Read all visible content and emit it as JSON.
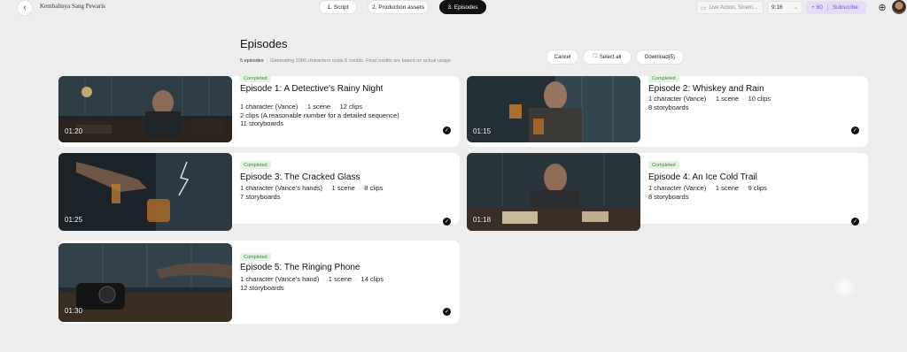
{
  "header": {
    "project_title": "Kembalinya Sang Pewaris",
    "steps": [
      "1. Script",
      "2. Production assets",
      "3. Episodes"
    ],
    "style_value": "Live Action, Sinem...",
    "ratio_value": "9:16",
    "credits": "+ 60",
    "subscribe": "Subscribe",
    "language_icon": "translate-icon"
  },
  "page": {
    "title": "Episodes",
    "count": "5 episodes",
    "cost_note": "Generating 1080 characters costs",
    "cost_credits": "6",
    "credits_word": "credits.",
    "final_note": "Final credits are based on actual usage."
  },
  "actions": {
    "cancel": "Cancel",
    "select_all": "Select all",
    "download": "Download(5)"
  },
  "episodes": [
    {
      "status": "Completed",
      "title": "Episode 1: A Detective's Rainy Night",
      "characters": "1 character (Vance)",
      "scenes": "1 scene",
      "clips": "12 clips",
      "extra": "2 clips (A reasonable number for a detailed sequence)",
      "storyboards": "11 storyboards",
      "duration": "01:20"
    },
    {
      "status": "Completed",
      "title": "Episode 2: Whiskey and Rain",
      "characters": "1 character (Vance)",
      "scenes": "1 scene",
      "clips": "10 clips",
      "storyboards": "8 storyboards",
      "duration": "01:15"
    },
    {
      "status": "Completed",
      "title": "Episode 3: The Cracked Glass",
      "characters": "1 character (Vance's hands)",
      "scenes": "1 scene",
      "clips": "8 clips",
      "storyboards": "7 storyboards",
      "duration": "01:25"
    },
    {
      "status": "Completed",
      "title": "Episode 4: An Ice Cold Trail",
      "characters": "1 character (Vance)",
      "scenes": "1 scene",
      "clips": "9 clips",
      "storyboards": "8 storyboards",
      "duration": "01:18"
    },
    {
      "status": "Completed",
      "title": "Episode 5: The Ringing Phone",
      "characters": "1 character (Vance's hand)",
      "scenes": "1 scene",
      "clips": "14 clips",
      "storyboards": "12 storyboards",
      "duration": "01:30"
    }
  ]
}
